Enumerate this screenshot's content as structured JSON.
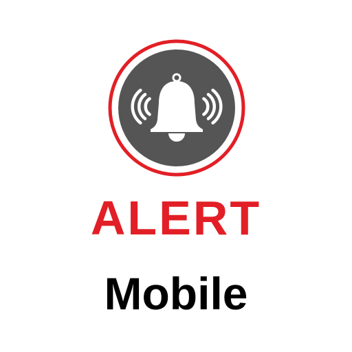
{
  "logo": {
    "word_primary": "ALERT",
    "word_secondary": "Mobile",
    "icon": "ringing-bell-icon",
    "colors": {
      "brand_red": "#e21f26",
      "badge_gray": "#555555",
      "bell_white": "#ffffff",
      "text_black": "#000000"
    }
  }
}
